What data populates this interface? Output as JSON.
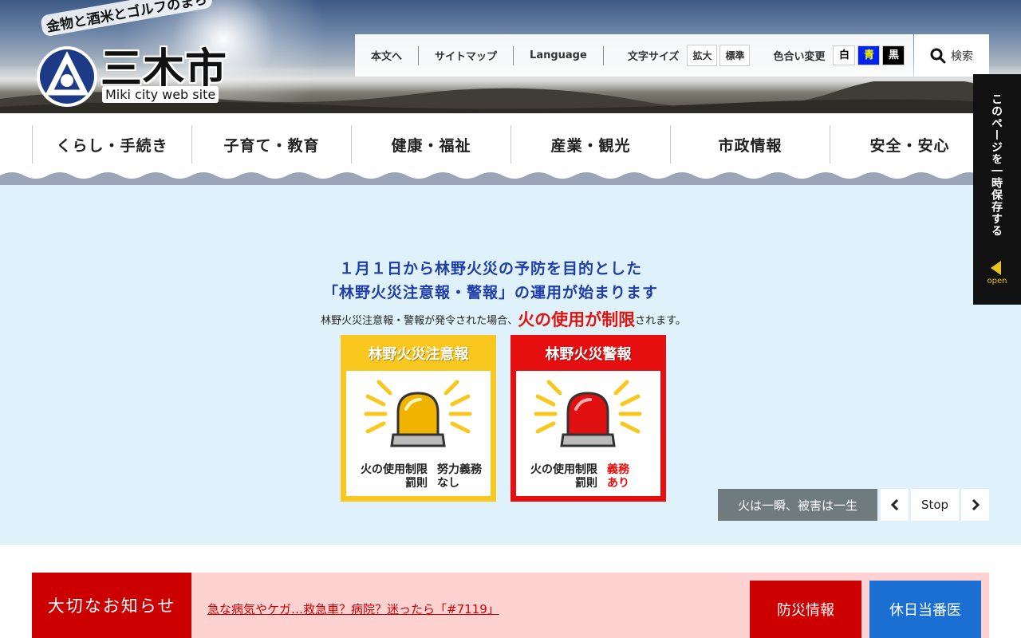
{
  "header": {
    "tagline": "金物と酒米とゴルフのまち",
    "city_name": "三木市",
    "subtitle": "Miki city web site",
    "logo_icon": "miki-city-emblem-icon"
  },
  "utility": {
    "skip_to_content": "本文へ",
    "sitemap": "サイトマップ",
    "language": "Language",
    "font_size_label": "文字サイズ",
    "font_size_large": "拡大",
    "font_size_normal": "標準",
    "color_label": "色合い変更",
    "color_white": "白",
    "color_blue": "青",
    "color_black": "黒",
    "search": "検索",
    "search_icon": "search-icon"
  },
  "nav": {
    "items": [
      {
        "label": "くらし・手続き"
      },
      {
        "label": "子育て・教育"
      },
      {
        "label": "健康・福祉"
      },
      {
        "label": "産業・観光"
      },
      {
        "label": "市政情報"
      },
      {
        "label": "安全・安心"
      }
    ]
  },
  "side_tab": {
    "label": "このページを一時保存する",
    "open": "open"
  },
  "hero": {
    "line1": "１月１日から林野火災の予防を目的とした",
    "line2": "「林野火災注意報・警報」の運用が始まります",
    "line3_pre": "林野火災注意報・警報が発令された場合、",
    "line3_highlight": "火の使用が制限",
    "line3_post": "されます。",
    "cards": [
      {
        "title": "林野火災注意報",
        "text_left": "火の使用制限\n罰則",
        "text_right": "努力義務\nなし"
      },
      {
        "title": "林野火災警報",
        "text_left": "火の使用制限\n罰則",
        "text_right": "義務\nあり"
      }
    ],
    "caption": "火は一瞬、被害は一生",
    "controls": {
      "prev": "‹",
      "stop": "Stop",
      "next": "›"
    }
  },
  "notice": {
    "label": "大切なお知らせ",
    "link": "急な病気やケガ…救急車？病院？迷ったら「#7119」",
    "disaster_button": "防災情報",
    "holiday_doctor_button": "休日当番医"
  },
  "colors": {
    "nav_wave": "#9aa6b8",
    "hero_bg": "#dff2fb",
    "hero_title": "#1f3da8",
    "alert_red": "#e60f0f",
    "caution_yellow": "#f8c81e",
    "notice_red": "#cc0000",
    "notice_bg": "#ffd2d2",
    "doctor_blue": "#1b6fd2"
  }
}
